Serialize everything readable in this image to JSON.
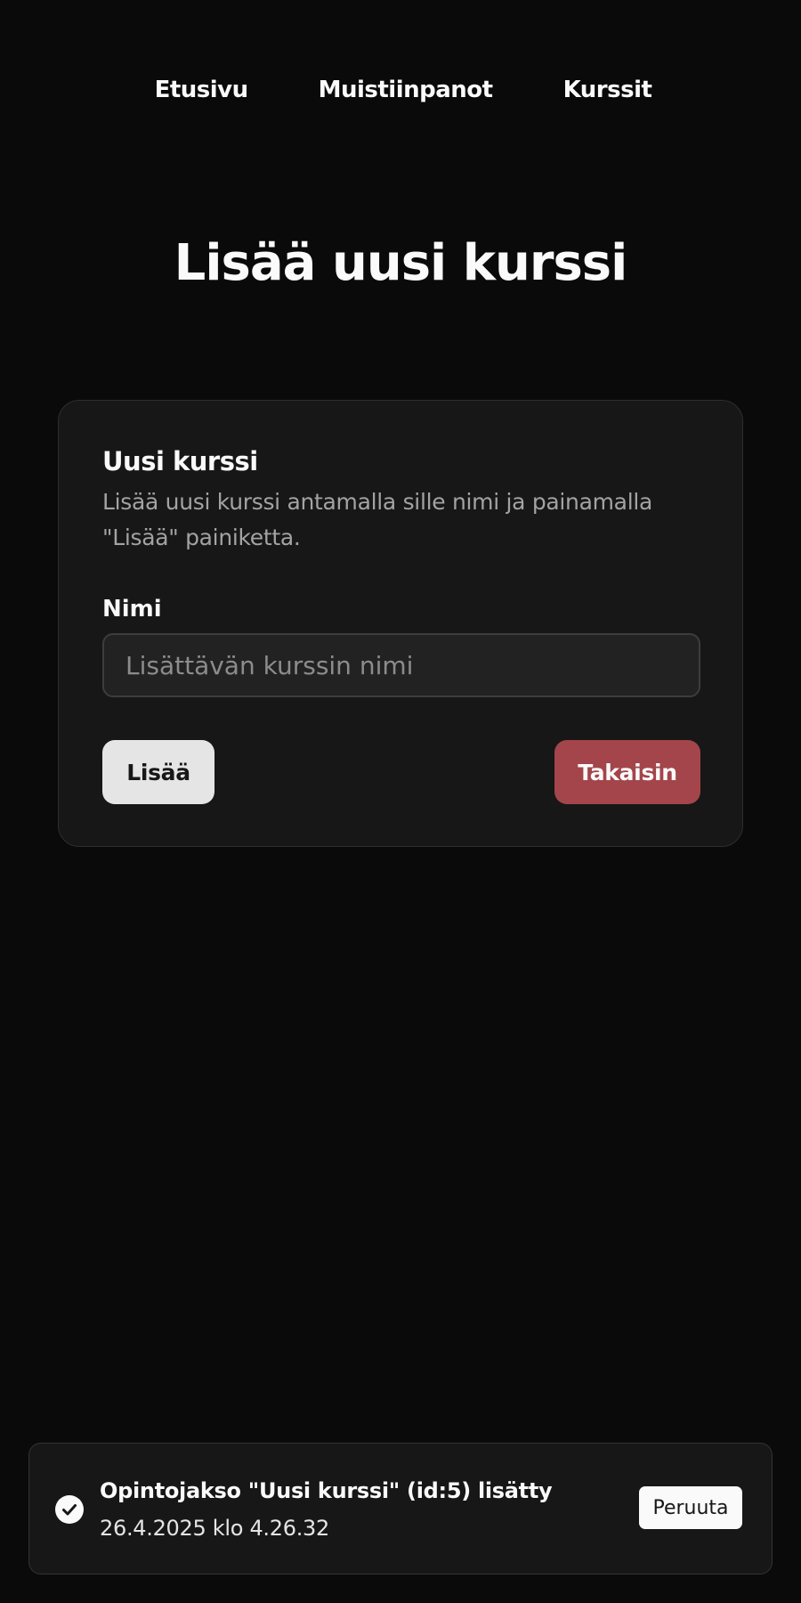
{
  "nav": {
    "items": [
      {
        "label": "Etusivu"
      },
      {
        "label": "Muistiinpanot"
      },
      {
        "label": "Kurssit"
      }
    ]
  },
  "page": {
    "title": "Lisää uusi kurssi"
  },
  "form": {
    "title": "Uusi kurssi",
    "description": "Lisää uusi kurssi antamalla sille nimi ja painamalla \"Lisää\" painiketta.",
    "name_label": "Nimi",
    "name_value": "",
    "name_placeholder": "Lisättävän kurssin nimi",
    "add_label": "Lisää",
    "back_label": "Takaisin"
  },
  "toast": {
    "icon": "check-circle-icon",
    "title": "Opintojakso \"Uusi kurssi\" (id:5) lisätty",
    "timestamp": "26.4.2025 klo 4.26.32",
    "action_label": "Peruuta"
  },
  "colors": {
    "background": "#0a0a0a",
    "card": "#171717",
    "back_button": "#a3454a",
    "add_button": "#e5e5e5"
  }
}
